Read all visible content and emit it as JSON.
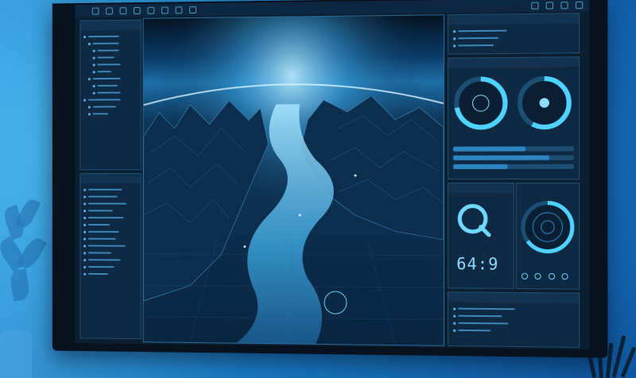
{
  "colors": {
    "accent": "#4fd2ff",
    "accent_dim": "#2a86c2",
    "panel": "#0f2942",
    "background_wall": "#1f8fd4"
  },
  "toolbar": {
    "icons": [
      "file-icon",
      "folder-icon",
      "save-icon",
      "cut-icon",
      "copy-icon",
      "paste-icon",
      "undo-icon",
      "redo-icon",
      "zoom-icon",
      "grid-icon",
      "layers-icon",
      "settings-icon"
    ]
  },
  "readout": {
    "value": "64:9"
  },
  "gauges": {
    "top_left_level": 0.72,
    "top_right_level": 0.58,
    "bottom_right_level": 0.65
  }
}
